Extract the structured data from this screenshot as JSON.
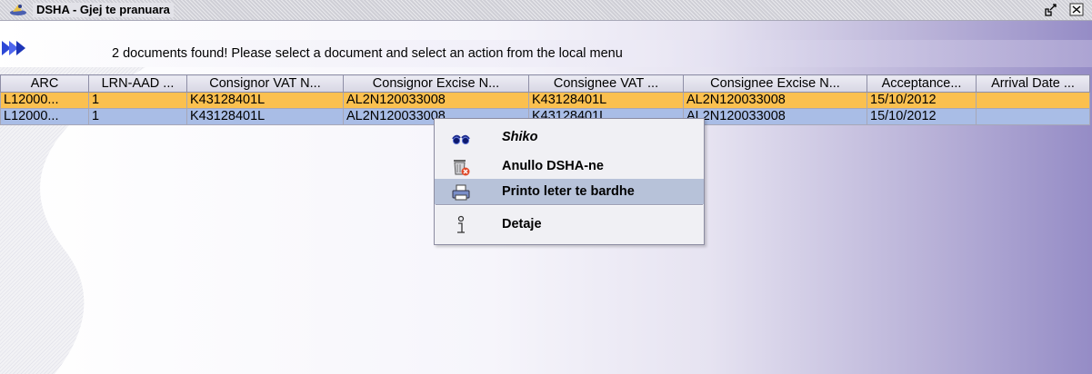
{
  "window": {
    "title": "DSHA - Gjej te pranuara",
    "icons": {
      "app": "app-logo-icon",
      "restore": "restore-icon",
      "close": "close-icon"
    }
  },
  "info": {
    "icon": "double-arrow-icon",
    "message": "2 documents found! Please select a document and select an action from the local menu"
  },
  "table": {
    "columns": [
      "ARC",
      "LRN-AAD ...",
      "Consignor VAT N...",
      "Consignor Excise N...",
      "Consignee VAT ...",
      "Consignee Excise N...",
      "Acceptance...",
      "Arrival Date ..."
    ],
    "rows": [
      [
        "L12000...",
        "1",
        "K43128401L",
        "AL2N120033008",
        "K43128401L",
        "AL2N120033008",
        "15/10/2012",
        ""
      ],
      [
        "L12000...",
        "1",
        "K43128401L",
        "AL2N120033008",
        "K43128401L",
        "AL2N120033008",
        "15/10/2012",
        ""
      ]
    ]
  },
  "context_menu": {
    "items": [
      {
        "label": "Shiko",
        "icon": "glasses-icon"
      },
      {
        "label": "Anullo DSHA-ne",
        "icon": "trash-cancel-icon"
      },
      {
        "label": "Printo leter te bardhe",
        "icon": "printer-icon"
      },
      {
        "label": "Detaje",
        "icon": "info-icon"
      }
    ]
  },
  "colors": {
    "selected_row": "#fbc04f",
    "second_row": "#a9bde6",
    "menu_highlight": "#b7c2d9",
    "gradient_end": "#958cc6"
  }
}
